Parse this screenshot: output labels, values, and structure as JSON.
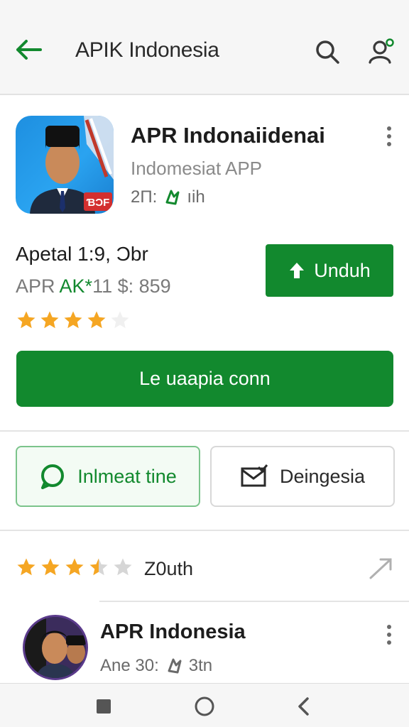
{
  "appbar": {
    "title": "APIK Indonesia",
    "back_icon": "arrow-left-icon",
    "search_icon": "search-icon",
    "account_icon": "account-icon"
  },
  "app": {
    "name": "APR Indonaiidenai",
    "developer": "Indomesiat APP",
    "meta_left": "2Π:",
    "meta_right": "ıih",
    "icon_badge": "ƁƆF"
  },
  "stats": {
    "line1": "Apetal 1:9, Ɔbr",
    "line2_prefix": "APR ",
    "line2_accent": "AK*",
    "line2_suffix": "11 $: 859",
    "stars_filled": 4
  },
  "buttons": {
    "unduh": "Unduh",
    "wide": "Le uaapia conn"
  },
  "chips": {
    "green": "Inlmeat tine",
    "plain": "Deingesia"
  },
  "rating": {
    "label": "Z0uth",
    "value": 3.5
  },
  "list_item": {
    "title": "APR Indonesia",
    "meta_left": "Ane 30:",
    "meta_right": "3tn"
  },
  "colors": {
    "primary": "#12892e",
    "star": "#f5a623",
    "appbar_bg": "#f6f6f6"
  }
}
